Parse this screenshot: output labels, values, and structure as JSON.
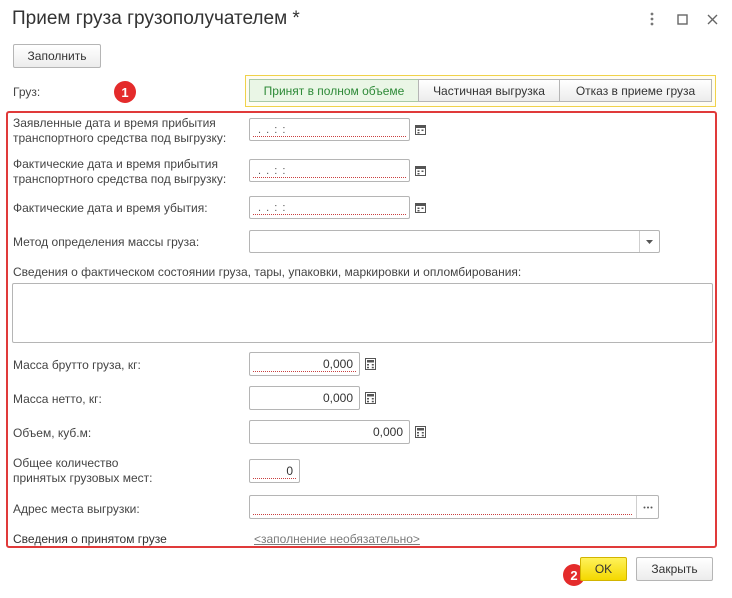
{
  "window": {
    "title": "Прием груза грузополучателем *"
  },
  "toolbar": {
    "fill_label": "Заполнить"
  },
  "cargo": {
    "label": "Груз:",
    "options": [
      {
        "label": "Принят в полном объеме",
        "active": true
      },
      {
        "label": "Частичная выгрузка",
        "active": false
      },
      {
        "label": "Отказ в приеме груза",
        "active": false
      }
    ]
  },
  "form": {
    "declared_arrival_label_1": "Заявленные дата и время прибытия",
    "declared_arrival_label_2": "транспортного средства под выгрузку:",
    "actual_arrival_label_1": "Фактические дата и время прибытия",
    "actual_arrival_label_2": "транспортного средства под выгрузку:",
    "actual_departure_label": "Фактические дата и время убытия:",
    "date_mask": ".  .       :  :",
    "mass_method_label": "Метод определения массы груза:",
    "mass_method_value": "",
    "condition_label": "Сведения о фактическом состоянии груза, тары, упаковки, маркировки и опломбирования:",
    "condition_value": "",
    "gross_mass_label": "Масса брутто груза, кг:",
    "gross_mass_value": "0,000",
    "net_mass_label": "Масса нетто, кг:",
    "net_mass_value": "0,000",
    "volume_label": "Объем, куб.м:",
    "volume_value": "0,000",
    "places_label_1": "Общее количество",
    "places_label_2": "принятых грузовых мест:",
    "places_value": "0",
    "unload_address_label": "Адрес места выгрузки:",
    "unload_address_value": "",
    "accepted_info_label": "Сведения о принятом грузе",
    "accepted_info_link": "<заполнение необязательно>"
  },
  "badges": {
    "first": "1",
    "second": "2"
  },
  "footer": {
    "ok_label": "OK",
    "close_label": "Закрыть"
  },
  "colors": {
    "highlight_border": "#e03a3a",
    "badge": "#e42b2b",
    "active_option_text": "#2e8a38",
    "ok_button": "#f4d800"
  }
}
